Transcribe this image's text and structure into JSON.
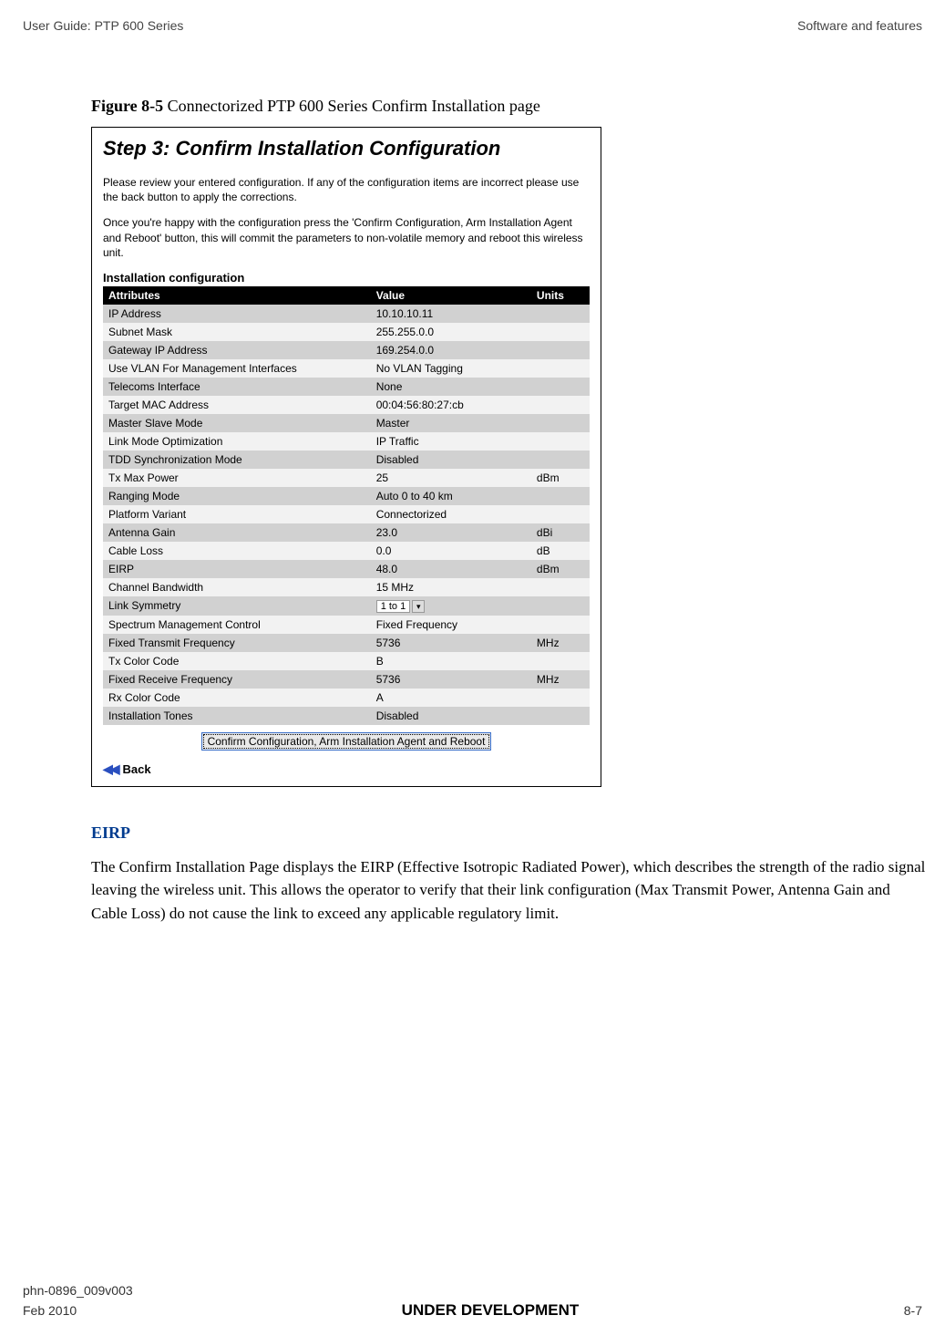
{
  "header": {
    "left": "User Guide: PTP 600 Series",
    "right": "Software and features"
  },
  "figure": {
    "label": "Figure 8-5",
    "caption_rest": "  Connectorized PTP 600 Series Confirm Installation page",
    "step_title": "Step 3: Confirm Installation Configuration",
    "intro1": "Please review your entered configuration. If any of the configuration items are incorrect please use the back button to apply the corrections.",
    "intro2": "Once you're happy with the configuration press the 'Confirm Configuration, Arm Installation Agent and Reboot' button, this will commit the parameters to non-volatile memory and reboot this wireless unit.",
    "section_label": "Installation configuration",
    "table": {
      "headers": {
        "attr": "Attributes",
        "val": "Value",
        "unit": "Units"
      },
      "rows": [
        {
          "attr": "IP Address",
          "val": "10.10.10.11",
          "unit": ""
        },
        {
          "attr": "Subnet Mask",
          "val": "255.255.0.0",
          "unit": ""
        },
        {
          "attr": "Gateway IP Address",
          "val": "169.254.0.0",
          "unit": ""
        },
        {
          "attr": "Use VLAN For Management Interfaces",
          "val": "No VLAN Tagging",
          "unit": ""
        },
        {
          "attr": "Telecoms Interface",
          "val": "None",
          "unit": ""
        },
        {
          "attr": "Target MAC Address",
          "val": "00:04:56:80:27:cb",
          "unit": ""
        },
        {
          "attr": "Master Slave Mode",
          "val": "Master",
          "unit": ""
        },
        {
          "attr": "Link Mode Optimization",
          "val": "IP Traffic",
          "unit": ""
        },
        {
          "attr": "TDD Synchronization Mode",
          "val": "Disabled",
          "unit": ""
        },
        {
          "attr": "Tx Max Power",
          "val": "25",
          "unit": "dBm"
        },
        {
          "attr": "Ranging Mode",
          "val": "Auto 0 to 40 km",
          "unit": ""
        },
        {
          "attr": "Platform Variant",
          "val": "Connectorized",
          "unit": ""
        },
        {
          "attr": "Antenna Gain",
          "val": "23.0",
          "unit": "dBi"
        },
        {
          "attr": "Cable Loss",
          "val": "0.0",
          "unit": "dB"
        },
        {
          "attr": "EIRP",
          "val": "48.0",
          "unit": "dBm"
        },
        {
          "attr": "Channel Bandwidth",
          "val": "15 MHz",
          "unit": ""
        },
        {
          "attr": "Link Symmetry",
          "val": "1 to 1",
          "unit": "",
          "dropdown": true
        },
        {
          "attr": "Spectrum Management Control",
          "val": "Fixed Frequency",
          "unit": ""
        },
        {
          "attr": "Fixed Transmit Frequency",
          "val": "5736",
          "unit": "MHz"
        },
        {
          "attr": "Tx Color Code",
          "val": "B",
          "unit": ""
        },
        {
          "attr": "Fixed Receive Frequency",
          "val": "5736",
          "unit": "MHz"
        },
        {
          "attr": "Rx Color Code",
          "val": "A",
          "unit": ""
        },
        {
          "attr": "Installation Tones",
          "val": "Disabled",
          "unit": ""
        }
      ]
    },
    "confirm_button": "Confirm Configuration, Arm Installation Agent and Reboot",
    "back_label": "Back"
  },
  "eirp": {
    "heading": "EIRP",
    "para": "The Confirm Installation Page displays the EIRP (Effective Isotropic Radiated Power), which describes the strength of the radio signal leaving the wireless unit.  This allows the operator to verify that their link configuration (Max Transmit Power, Antenna Gain and Cable Loss) do not cause the link to exceed any applicable regulatory limit."
  },
  "footer": {
    "doc_id": "phn-0896_009v003",
    "date": "Feb 2010",
    "center": "UNDER DEVELOPMENT",
    "page": "8-7"
  }
}
